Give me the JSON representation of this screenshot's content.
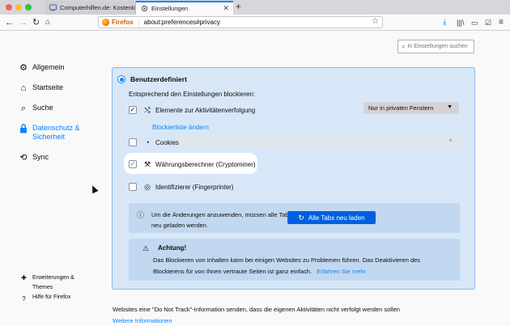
{
  "tabs": [
    {
      "label": "Computerhilfen.de: Kostenlos"
    },
    {
      "label": "Einstellungen"
    }
  ],
  "urlbar": {
    "identity": "Firefox",
    "url": "about:preferences#privacy"
  },
  "search": {
    "placeholder": "In Einstellungen suchen"
  },
  "sidebar": {
    "items": [
      {
        "label": "Allgemein",
        "icon": "gear-icon"
      },
      {
        "label": "Startseite",
        "icon": "home-icon"
      },
      {
        "label": "Suche",
        "icon": "search-icon"
      },
      {
        "label": "Datenschutz & Sicherheit",
        "icon": "lock-icon",
        "selected": true
      },
      {
        "label": "Sync",
        "icon": "sync-icon"
      }
    ],
    "bottom": [
      {
        "label": "Erweiterungen & Themes",
        "icon": "puzzle-icon"
      },
      {
        "label": "Hilfe für Firefox",
        "icon": "help-icon"
      }
    ]
  },
  "blocking": {
    "mode_label": "Benutzerdefiniert",
    "intro": "Entsprechend den Einstellungen blockieren:",
    "tracking": {
      "label": "Elemente zur Aktivitätenverfolgung",
      "checked": true,
      "dropdown": "Nur in privaten Fenstern",
      "link": "Blockierliste ändern"
    },
    "cookies": {
      "label": "Cookies",
      "checked": false
    },
    "cryptominers": {
      "label": "Währungsberechner (Cryptominer)",
      "checked": true
    },
    "fingerprinters": {
      "label": "Identifizierer (Fingerprinter)",
      "checked": false
    },
    "reload_info": "Um die Änderungen anzuwenden, müssen alle Tabs neu geladen werden.",
    "reload_button": "Alle Tabs neu laden",
    "warning_title": "Achtung!",
    "warning_body": "Das Blockieren von Inhalten kann bei einigen Websites zu Problemen führen. Das Deaktivieren des Blockierens für von Ihnen vertraute Seiten ist ganz einfach.",
    "warning_link": "Erfahren Sie mehr"
  },
  "dnt": {
    "text": "Websites eine \"Do Not Track\"-Information senden, dass die eigenen Aktivitäten nicht verfolgt werden sollen",
    "link": "Weitere Informationen"
  },
  "colors": {
    "accent": "#0a84ff",
    "panel": "#d8e7f7",
    "button": "#0060df"
  }
}
